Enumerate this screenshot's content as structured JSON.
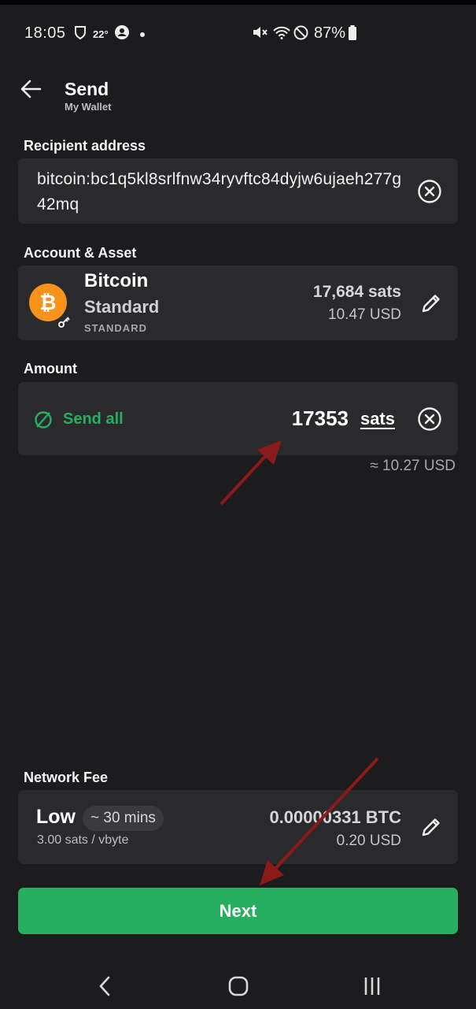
{
  "status_bar": {
    "time": "18:05",
    "temperature": "22°",
    "battery": "87%"
  },
  "header": {
    "title": "Send",
    "subtitle": "My Wallet",
    "back_icon": "arrow-left-icon"
  },
  "recipient": {
    "label": "Recipient address",
    "address": "bitcoin:bc1q5kl8srlfnw34ryvftc84dyjw6ujaeh277g42mq"
  },
  "account": {
    "label": "Account & Asset",
    "name": "Bitcoin",
    "type": "Standard",
    "tag": "STANDARD",
    "balance_sats": "17,684 sats",
    "balance_usd": "10.47 USD",
    "badge_glyph": "₿"
  },
  "amount": {
    "label": "Amount",
    "send_all_label": "Send all",
    "value": "17353",
    "unit": "sats",
    "approx_usd": "≈ 10.27 USD"
  },
  "network_fee": {
    "label": "Network Fee",
    "speed": "Low",
    "eta": "~ 30 mins",
    "rate": "3.00 sats / vbyte",
    "amount_btc": "0.00000331 BTC",
    "amount_usd": "0.20 USD"
  },
  "actions": {
    "next_label": "Next"
  },
  "colors": {
    "background": "#1c1c1f",
    "card": "#2a2a2d",
    "accent_green": "#27ae60",
    "bitcoin_orange": "#f7931a",
    "annotation_arrow": "#8b1a1a"
  }
}
